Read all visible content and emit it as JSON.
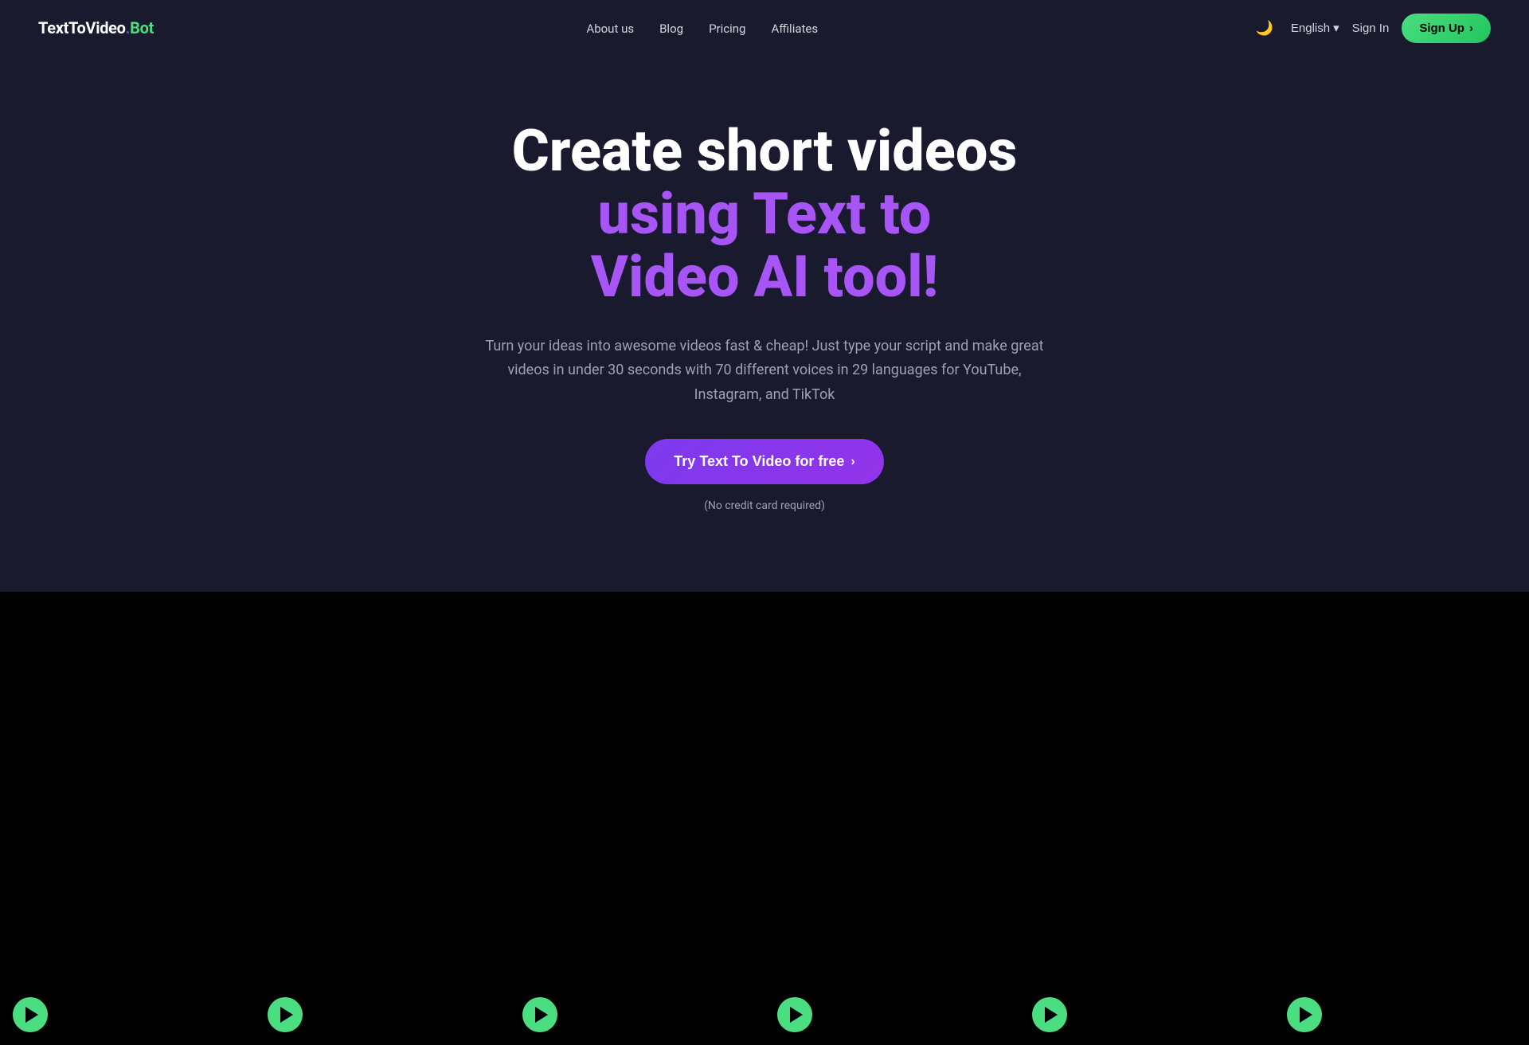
{
  "nav": {
    "logo": {
      "prefix": "TextToVideo",
      "dot": ".",
      "suffix": "Bot"
    },
    "links": [
      {
        "label": "About us",
        "id": "about-us"
      },
      {
        "label": "Blog",
        "id": "blog"
      },
      {
        "label": "Pricing",
        "id": "pricing"
      },
      {
        "label": "Affiliates",
        "id": "affiliates"
      }
    ],
    "dark_mode_icon": "🌙",
    "language": {
      "label": "English",
      "chevron": "▾"
    },
    "signin_label": "Sign In",
    "signup_label": "Sign Up",
    "signup_arrow": "›"
  },
  "hero": {
    "title_line1": "Create short videos",
    "title_line2_purple": "using Text to",
    "title_line3_purple": "Video AI tool!",
    "subtitle": "Turn your ideas into awesome videos fast & cheap! Just type your script and make great videos in under 30 seconds with 70 different voices in 29 languages for YouTube, Instagram, and TikTok",
    "cta_label": "Try Text To Video for free",
    "cta_arrow": "›",
    "no_cc_text": "(No credit card required)"
  },
  "videos": [
    {
      "id": 1
    },
    {
      "id": 2
    },
    {
      "id": 3
    },
    {
      "id": 4
    },
    {
      "id": 5
    },
    {
      "id": 6
    }
  ],
  "colors": {
    "bg": "#1a1a2e",
    "purple": "#a855f7",
    "green": "#4ade80",
    "white": "#ffffff",
    "gray": "#9ca3af"
  }
}
